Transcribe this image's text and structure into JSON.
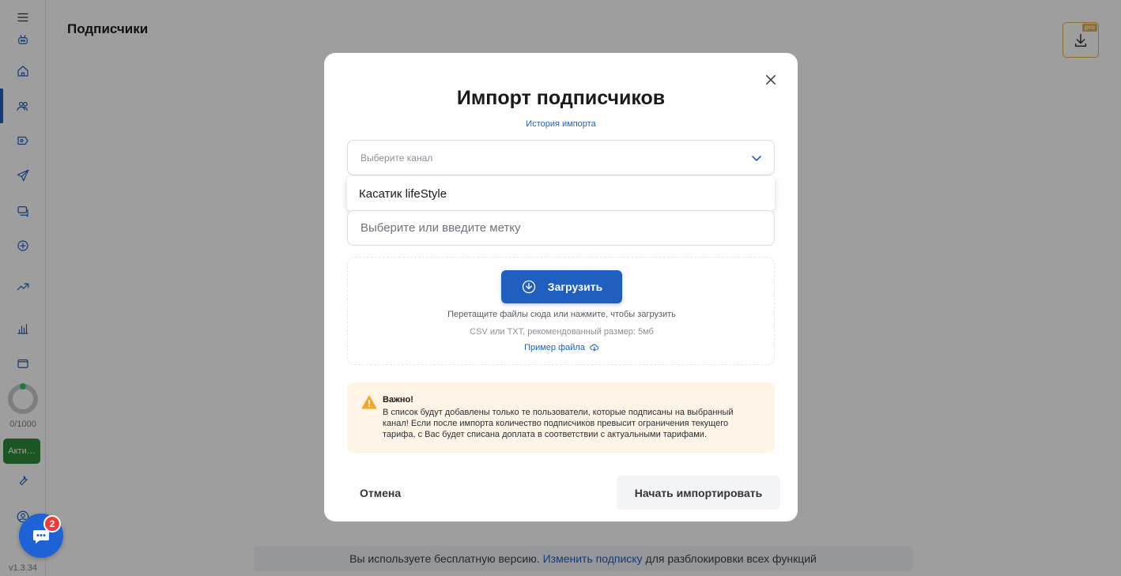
{
  "app": {
    "version": "v1.3.34",
    "page_title": "Подписчики",
    "pro_badge": "pro"
  },
  "sidebar": {
    "items": [
      {
        "name": "menu-icon"
      },
      {
        "name": "bot-icon"
      },
      {
        "name": "home-icon"
      },
      {
        "name": "users-icon",
        "active": true
      },
      {
        "name": "badge-icon"
      },
      {
        "name": "send-icon"
      },
      {
        "name": "chat-icon"
      },
      {
        "name": "palette-icon"
      },
      {
        "name": "trend-icon"
      },
      {
        "name": "analytics-icon"
      },
      {
        "name": "folder-icon"
      },
      {
        "name": "tools-icon"
      },
      {
        "name": "profile-icon"
      }
    ],
    "subscriber_count": "0/1000",
    "active_button": "Акти…"
  },
  "banner": {
    "prefix": "Вы используете бесплатную версию.",
    "link": "Изменить подписку",
    "suffix": "для разблокировки всех функций"
  },
  "chat": {
    "badge_count": "2"
  },
  "modal": {
    "title": "Импорт подписчиков",
    "history_link": "История импорта",
    "channel_placeholder": "Выберите канал",
    "dropdown_options": [
      "Касатик lifeStyle"
    ],
    "tag_placeholder": "Выберите или введите метку",
    "upload_label": "Загрузить",
    "drop_hint": "Перетащите файлы сюда или нажмите, чтобы загрузить",
    "formats": "CSV или TXT, рекомендованный размер: 5мб",
    "example_link": "Пример файла",
    "warning_title": "Важно!",
    "warning_text": "В список будут добавлены только те пользователи, которые подписаны на выбранный канал! Если после импорта количество подписчиков превысит ограничения текущего тарифа, с Вас будет списана доплата в соответствии с актуальными тарифами.",
    "cancel_label": "Отмена",
    "start_label": "Начать импортировать"
  },
  "colors": {
    "accent": "#1f5fbf",
    "active_green": "#2e8b3c",
    "warning_bg": "#fff4e5",
    "warning_icon": "#f5a623",
    "pro_gold": "#e2b24a",
    "chat_blue": "#1e63d6",
    "badge_red": "#ef3b3b"
  }
}
